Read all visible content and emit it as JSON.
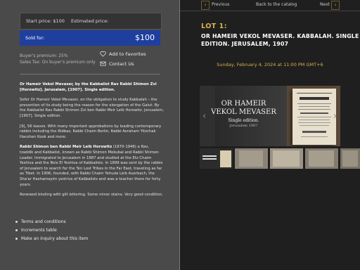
{
  "prices": {
    "start": "Start price: $100",
    "estimated": "Estimated price:",
    "sold_label": "Sold for:",
    "sold_value": "$100"
  },
  "premium": {
    "buyers": "Buyer's premium: 25%",
    "sales_tax": "Sales Tax: On buyer's premium only"
  },
  "actions": {
    "favorites": "Add to Favorites",
    "contact": "Contact Us"
  },
  "description": {
    "p1_bold": "Or Hameir Vekol Mevaser, by the Kabbalist Rav Rabbi Shimon Zvi [Horowitz]. Jerusalem, [1907]. Single edition.",
    "p2": "Sefer Or Hameir Vekol Mevaser, on the obligation to study Kabbalah – the prevention of its study being the reason for the elongation of the Galut. By the Kabbalist Rav Rabbi Shimon Zvi ben Rabbi Meir Leib Horowitz. Jerusalem, [1907]. Single edition.",
    "p3": "[9], 56 leaves. With many important approbations by leading contemporary rabbis including the Ridbaz, Rabbi Chaim Berlin, Rabbi Avraham Yitzchak Hacohen Kook and more.",
    "p4_bold": "Rabbi Shimon ben Rabbi Meir Leib Horowitz",
    "p4_rest": " (1870-1946) a Rav, tzaddik and Kabbalist, known as Rabbi Shimon Mekubal and Rabbi Shimon Leader. Immigrated to Jerusalem in 1887 and studied at the Etz Chaim Yeshiva and the Beis El Yeshiva of Kabbalists. In 1899 was sent by the rabbis of Jerusalem to search for the Ten Lost Tribes in the Far East, traveling as far as Tibet. In 1906, founded, with Rabbi Chaim Yehuda Leib Auerbach, the Sha'ar Hashamayim yeshiva of Kabbalists and was a teacher there for forty years.",
    "p5": "Renewed binding with gilt lettering. Some minor stains. Very good condition."
  },
  "links": [
    "Terms and conditions",
    "Increments table",
    "Make an inquiry about this item"
  ],
  "nav": {
    "previous": "Previous",
    "back": "Back to the catalog",
    "next": "Next",
    "prev_arrow": "‹",
    "next_arrow": "›"
  },
  "lot": {
    "number": "LOT 1:",
    "title": "Or Hameir Vekol Mevaser. Kabbalah. Single edition. Jerusalem, 1907",
    "date": "Sunday, February 4, 2024 at 11:00 PM GMT+6"
  },
  "image": {
    "title_line1": "OR HAMEIR",
    "title_line2": "VEKOL MEVASER",
    "subtitle": "Single edition.",
    "place": "Jerusalem 1907",
    "prev_arrow": "‹",
    "next_arrow": "›"
  },
  "colors": {
    "gold": "#d8b24c",
    "sold_blue": "#1f3f9e"
  }
}
